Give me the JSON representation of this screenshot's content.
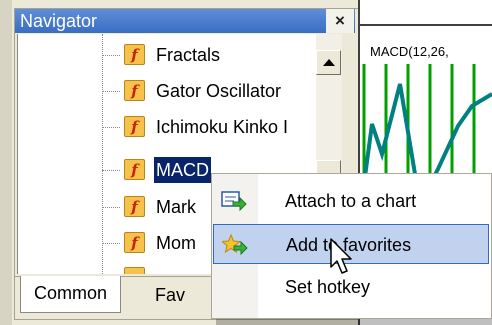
{
  "navigator": {
    "title": "Navigator",
    "close_label": "×",
    "items": [
      {
        "label": "Fractals",
        "icon": "function-icon",
        "selected": false
      },
      {
        "label": "Gator Oscillator",
        "icon": "function-icon",
        "selected": false
      },
      {
        "label": "Ichimoku Kinko I",
        "icon": "function-icon",
        "selected": false
      },
      {
        "label": "MACD",
        "icon": "function-icon",
        "selected": true
      },
      {
        "label": "Mark",
        "icon": "function-icon",
        "selected": false
      },
      {
        "label": "Mom",
        "icon": "function-icon",
        "selected": false
      }
    ],
    "tabs": [
      "Common",
      "Fav"
    ]
  },
  "chart": {
    "title": "MACD(12,26,",
    "line_color": "#008080",
    "grid_color": "#00a000"
  },
  "context_menu": {
    "items": [
      {
        "label": "Attach to a chart",
        "icon": "attach-chart-icon",
        "hovered": false
      },
      {
        "label": "Add to favorites",
        "icon": "add-favorites-icon",
        "hovered": true
      },
      {
        "label": "Set hotkey",
        "icon": "",
        "hovered": false
      }
    ]
  },
  "colors": {
    "title_bar": "#3a6cc2",
    "selection": "#0a246a",
    "menu_hover": "#c1d2ee"
  }
}
